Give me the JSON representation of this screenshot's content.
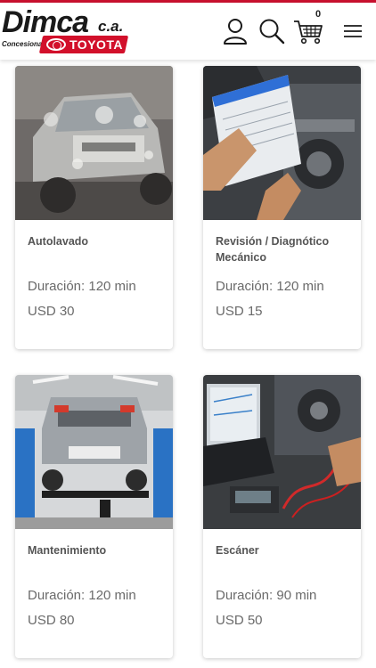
{
  "brand": {
    "name": "Dimca",
    "suffix": "c.a.",
    "tagline": "Concesionario",
    "partner": "TOYOTA"
  },
  "header": {
    "cart_count": "0",
    "icons": [
      "user-icon",
      "search-icon",
      "cart-icon",
      "menu-icon"
    ]
  },
  "services": [
    {
      "title": "Autolavado",
      "duration": "Duración: 120 min",
      "price": "USD 30",
      "image": "car-wash-photo"
    },
    {
      "title": "Revisión / Diagnótico Mecánico",
      "duration": "Duración: 120 min",
      "price": "USD 15",
      "image": "engine-inspection-photo"
    },
    {
      "title": "Mantenimiento",
      "duration": "Duración: 120 min",
      "price": "USD 80",
      "image": "car-lift-photo"
    },
    {
      "title": "Escáner",
      "duration": "Duración: 90 min",
      "price": "USD 50",
      "image": "diagnostic-scanner-photo"
    }
  ],
  "colors": {
    "brand_red": "#d2102b",
    "text_gray": "#555555"
  }
}
